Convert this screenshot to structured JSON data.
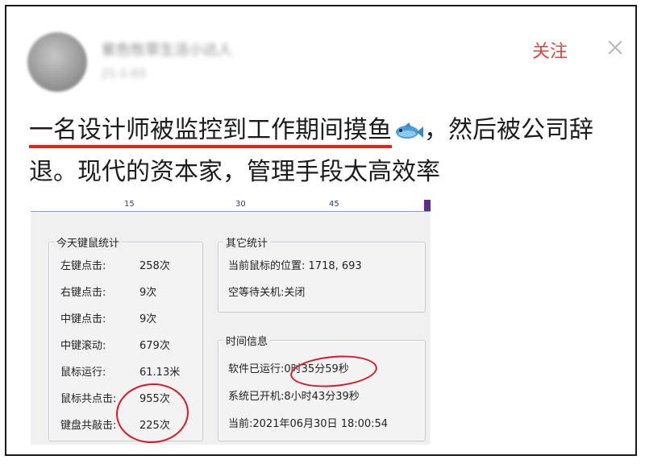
{
  "post": {
    "username": "紫色牧草生活小达人",
    "time": "21-1-03",
    "follow_label": "关注",
    "text_highlight": "一名设计师被监控到工作期间摸鱼",
    "text_rest_line1": "，然后被公司辞",
    "text_line2": "退。现代的资本家，管理手段太高效率",
    "emoji": "fish-emoji"
  },
  "ruler": {
    "marks": [
      "15",
      "30",
      "45"
    ]
  },
  "stats_today": {
    "title": "今天键鼠统计",
    "rows": [
      {
        "label": "左键点击:",
        "value": "258次"
      },
      {
        "label": "右键点击:",
        "value": "9次"
      },
      {
        "label": "中键点击:",
        "value": "9次"
      },
      {
        "label": "中键滚动:",
        "value": "679次"
      },
      {
        "label": "鼠标运行:",
        "value": "61.13米"
      },
      {
        "label": "鼠标共点击:",
        "value": "955次"
      },
      {
        "label": "键盘共敲击:",
        "value": "225次"
      }
    ]
  },
  "stats_other": {
    "title": "其它统计",
    "rows": [
      {
        "label": "当前鼠标的位置:",
        "value": "1718, 693"
      },
      {
        "label": "空等待关机:",
        "value": "关闭"
      }
    ]
  },
  "time_info": {
    "title": "时间信息",
    "rows": [
      {
        "label": "软件已运行:",
        "value": "0时35分59秒"
      },
      {
        "label": "系统已开机:",
        "value": "8小时43分39秒"
      },
      {
        "label": "当前:",
        "value": "2021年06月30日  18:00:54"
      }
    ]
  },
  "colors": {
    "accent_red": "#e2453c",
    "circle_red": "#d8192a"
  }
}
